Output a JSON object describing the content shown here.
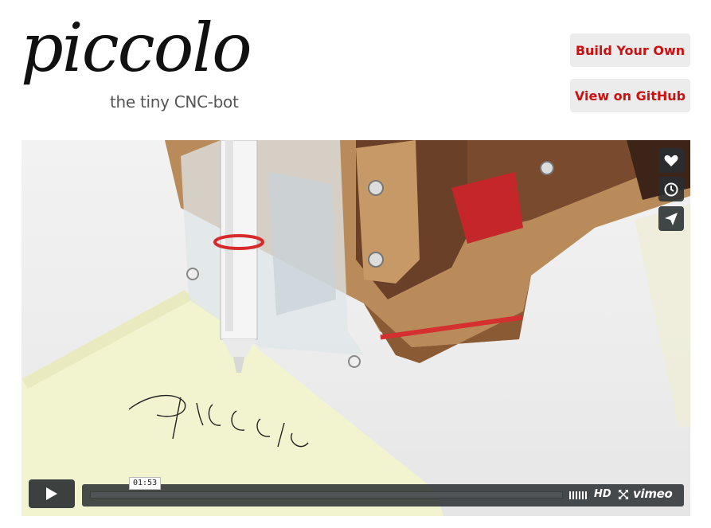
{
  "logo": {
    "word": "piccolo",
    "tagline": "the tiny CNC-bot"
  },
  "actions": {
    "build_label": "Build Your Own",
    "github_label": "View on GitHub"
  },
  "video": {
    "handwriting": "piccolo",
    "time_label": "01:53",
    "hd_label": "HD",
    "brand_label": "vimeo",
    "side_buttons": [
      "heart-icon",
      "clock-icon",
      "send-icon"
    ],
    "control_icons": [
      "play-icon",
      "volume-icon",
      "fullscreen-icon"
    ]
  },
  "colors": {
    "button_text": "#cc1111",
    "button_bg": "#ececec",
    "player_chrome": "#282d30"
  }
}
